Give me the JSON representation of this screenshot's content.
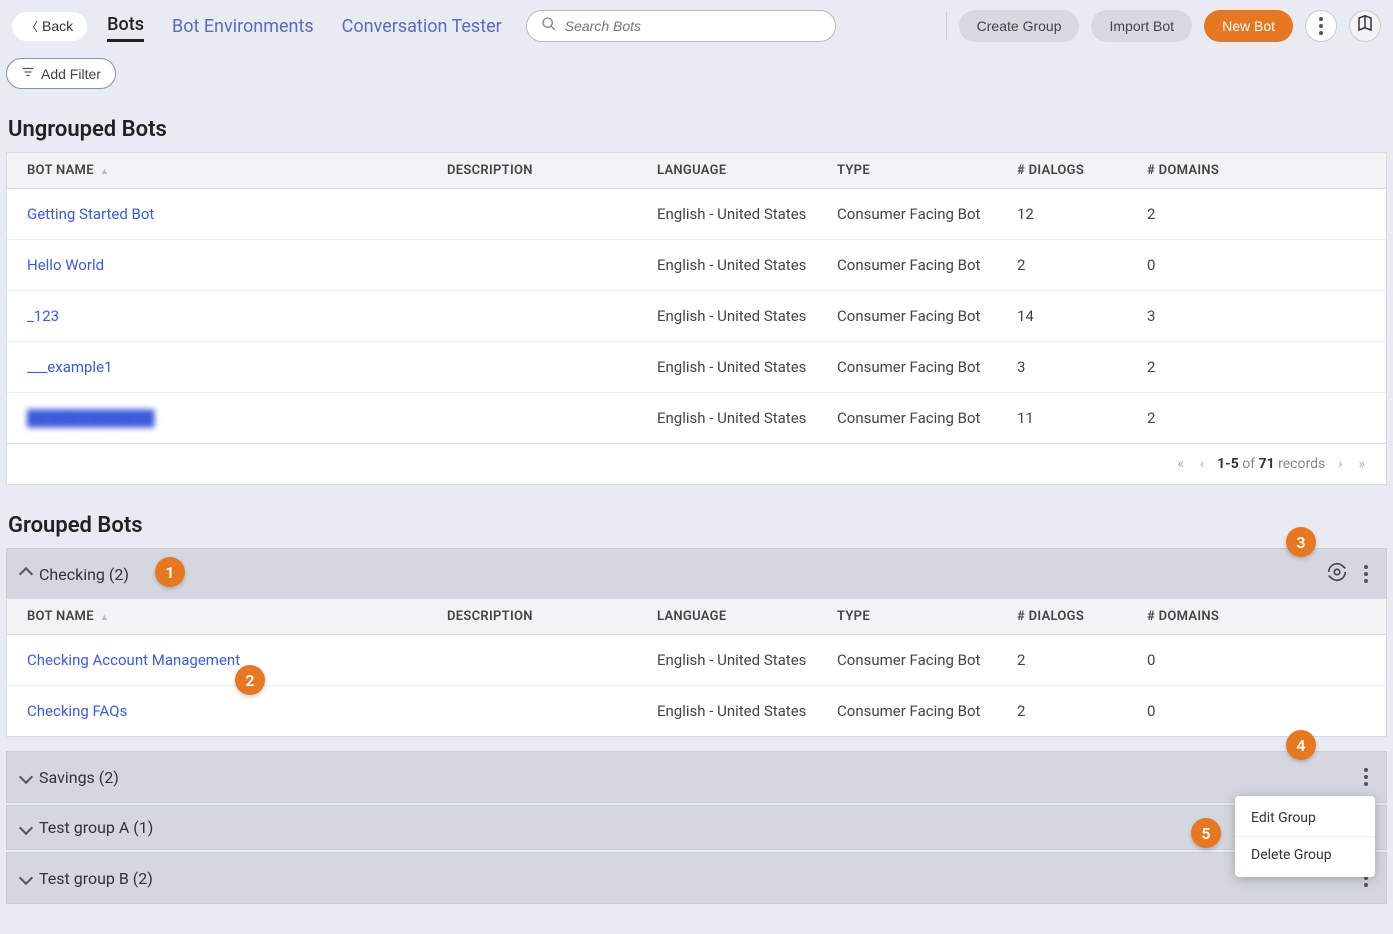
{
  "header": {
    "back_label": "Back",
    "tabs": {
      "bots": "Bots",
      "environments": "Bot Environments",
      "tester": "Conversation Tester"
    },
    "search_placeholder": "Search Bots",
    "create_group": "Create Group",
    "import_bot": "Import Bot",
    "new_bot": "New Bot"
  },
  "filter": {
    "add_filter": "Add Filter"
  },
  "ungrouped": {
    "title": "Ungrouped Bots",
    "rows": [
      {
        "name": "Getting Started Bot",
        "desc": "",
        "lang": "English - United States",
        "type": "Consumer Facing Bot",
        "dialogs": "12",
        "domains": "2"
      },
      {
        "name": "Hello World",
        "desc": "",
        "lang": "English - United States",
        "type": "Consumer Facing Bot",
        "dialogs": "2",
        "domains": "0"
      },
      {
        "name": "_123",
        "desc": "",
        "lang": "English - United States",
        "type": "Consumer Facing Bot",
        "dialogs": "14",
        "domains": "3"
      },
      {
        "name": "___example1",
        "desc": "",
        "lang": "English - United States",
        "type": "Consumer Facing Bot",
        "dialogs": "3",
        "domains": "2"
      },
      {
        "name": "",
        "desc": "",
        "lang": "English - United States",
        "type": "Consumer Facing Bot",
        "dialogs": "11",
        "domains": "2"
      }
    ]
  },
  "columns": {
    "name": "BOT NAME",
    "desc": "DESCRIPTION",
    "lang": "LANGUAGE",
    "type": "TYPE",
    "dialogs": "# DIALOGS",
    "domains": "# DOMAINS"
  },
  "pagination": {
    "range": "1-5",
    "of": "of",
    "total": "71",
    "records": "records"
  },
  "grouped": {
    "title": "Grouped Bots",
    "groups": {
      "checking": {
        "label": "Checking (2)"
      },
      "savings": {
        "label": "Savings (2)"
      },
      "test_a": {
        "label": "Test group A (1)"
      },
      "test_b": {
        "label": "Test group B (2)"
      }
    },
    "checking_rows": [
      {
        "name": "Checking Account Management",
        "desc": "",
        "lang": "English - United States",
        "type": "Consumer Facing Bot",
        "dialogs": "2",
        "domains": "0"
      },
      {
        "name": "Checking FAQs",
        "desc": "",
        "lang": "English - United States",
        "type": "Consumer Facing Bot",
        "dialogs": "2",
        "domains": "0"
      }
    ]
  },
  "popup": {
    "edit": "Edit Group",
    "delete": "Delete Group"
  },
  "callouts": {
    "c1": "1",
    "c2": "2",
    "c3": "3",
    "c4": "4",
    "c5": "5"
  }
}
